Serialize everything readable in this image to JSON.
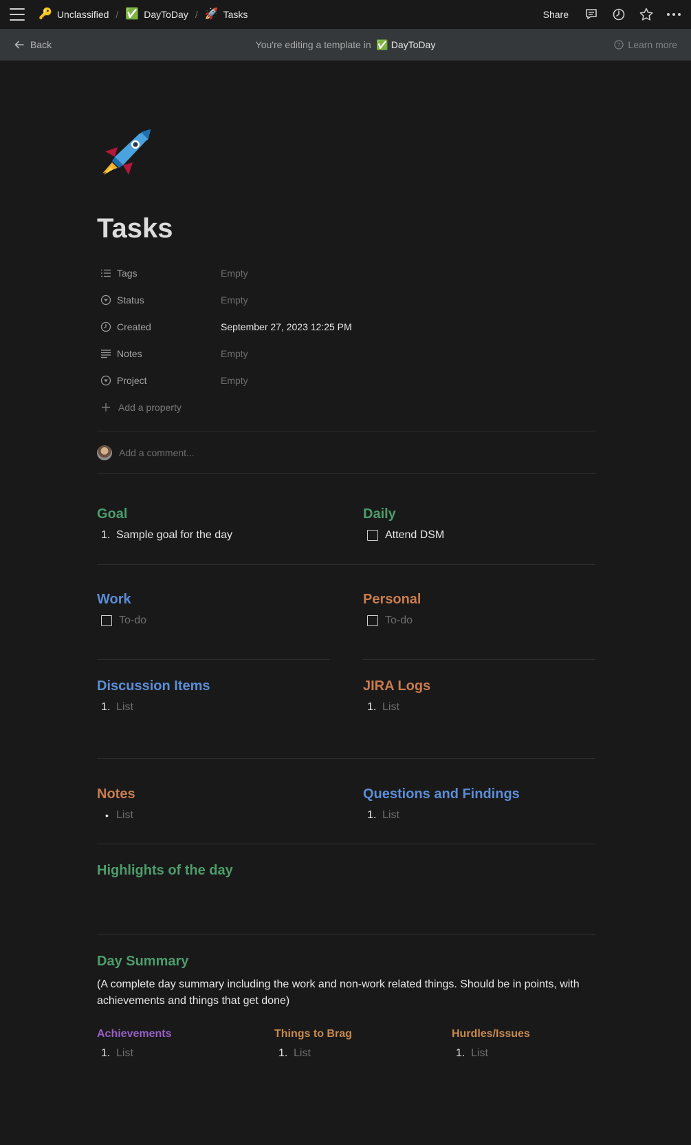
{
  "breadcrumb": {
    "items": [
      {
        "icon": "🔑",
        "label": "Unclassified"
      },
      {
        "icon": "✅",
        "label": "DayToDay"
      },
      {
        "icon": "🚀",
        "label": "Tasks"
      }
    ],
    "separator": "/"
  },
  "topbar": {
    "share_label": "Share"
  },
  "banner": {
    "back_label": "Back",
    "editing_text": "You're editing a template in",
    "db_icon": "✅",
    "db_name": "DayToDay",
    "learn_more": "Learn more"
  },
  "page": {
    "icon": "🚀",
    "title": "Tasks"
  },
  "properties": [
    {
      "name": "Tags",
      "value": "Empty"
    },
    {
      "name": "Status",
      "value": "Empty"
    },
    {
      "name": "Created",
      "value": "September 27, 2023 12:25 PM"
    },
    {
      "name": "Notes",
      "value": "Empty"
    },
    {
      "name": "Project",
      "value": "Empty"
    }
  ],
  "add_property": "Add a property",
  "comment_placeholder": "Add a comment...",
  "sections": {
    "goal": {
      "title": "Goal",
      "items": [
        {
          "num": "1.",
          "text": "Sample goal for the day"
        }
      ]
    },
    "daily": {
      "title": "Daily",
      "items": [
        {
          "text": "Attend DSM"
        }
      ]
    },
    "work": {
      "title": "Work",
      "items": [
        {
          "text": "To-do"
        }
      ]
    },
    "personal": {
      "title": "Personal",
      "items": [
        {
          "text": "To-do"
        }
      ]
    },
    "discussion": {
      "title": "Discussion Items",
      "items": [
        {
          "num": "1.",
          "text": "List"
        }
      ]
    },
    "jira": {
      "title": "JIRA Logs",
      "items": [
        {
          "num": "1.",
          "text": "List"
        }
      ]
    },
    "notes": {
      "title": "Notes",
      "items": [
        {
          "bullet": "•",
          "text": "List"
        }
      ]
    },
    "questions": {
      "title": "Questions and Findings",
      "items": [
        {
          "num": "1.",
          "text": "List"
        }
      ]
    },
    "highlights": {
      "title": "Highlights of the day"
    },
    "summary": {
      "title": "Day Summary",
      "description": "(A complete day summary including the work and non-work related things. Should be in points, with achievements and things that get done)"
    },
    "achievements": {
      "title": "Achievements",
      "items": [
        {
          "num": "1.",
          "text": "List"
        }
      ]
    },
    "brag": {
      "title": "Things to Brag",
      "items": [
        {
          "num": "1.",
          "text": "List"
        }
      ]
    },
    "hurdles": {
      "title": "Hurdles/Issues",
      "items": [
        {
          "num": "1.",
          "text": "List"
        }
      ]
    }
  }
}
